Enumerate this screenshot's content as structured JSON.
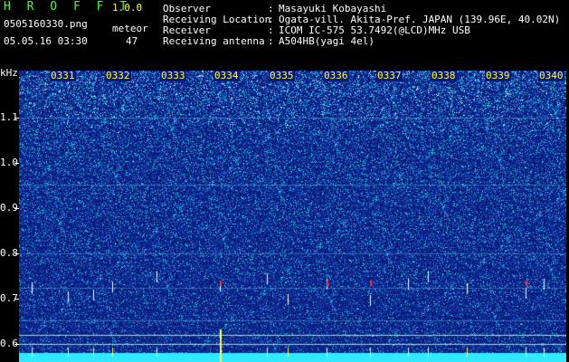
{
  "header": {
    "app_title": "H R O F F T",
    "version": "1.0.0",
    "filename": "0505160330.png",
    "meteor_label": "meteor",
    "datetime": "05.05.16 03:30",
    "meteor_count": "47"
  },
  "info": [
    {
      "key": "Observer",
      "sep": ":",
      "value": "Masayuki Kobayashi"
    },
    {
      "key": "Receiving Location",
      "sep": ":",
      "value": "Ogata-vill. Akita-Pref. JAPAN (139.96E, 40.02N)"
    },
    {
      "key": "Receiver",
      "sep": ":",
      "value": "ICOM IC-575 53.7492(@LCD)MHz USB"
    },
    {
      "key": "Receiving antenna",
      "sep": ":",
      "value": "A504HB(yagi 4el)"
    }
  ],
  "axis": {
    "unit": "kHz",
    "y_ticks": [
      "1.1",
      "1.0",
      "0.9",
      "0.8",
      "0.7",
      "0.6"
    ],
    "time_labels": [
      "0331",
      "0332",
      "0333",
      "0334",
      "0335",
      "0336",
      "0337",
      "0338",
      "0339",
      "0340"
    ]
  },
  "colors": {
    "background": "#000000",
    "spectrogram_base": "#0a1a78",
    "header_green": "#3cff3c",
    "time_label": "#ffff3c",
    "meteor_red": "#ff3030",
    "baseline_cyan": "#30e8ff"
  }
}
